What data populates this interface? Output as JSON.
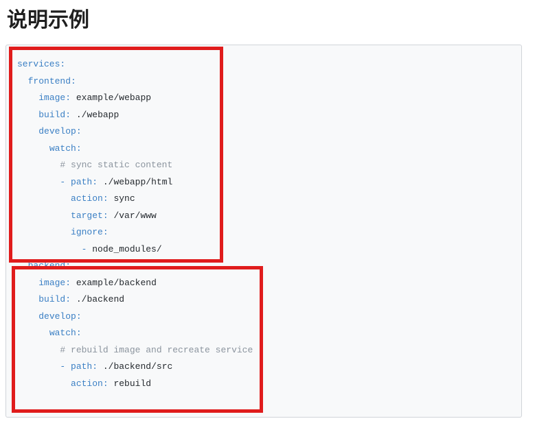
{
  "page": {
    "heading": "说明示例"
  },
  "code": {
    "language": "yaml",
    "lines": [
      {
        "indent": 0,
        "key": "services"
      },
      {
        "indent": 1,
        "key": "frontend"
      },
      {
        "indent": 2,
        "key": "image",
        "value": "example/webapp"
      },
      {
        "indent": 2,
        "key": "build",
        "value": "./webapp"
      },
      {
        "indent": 2,
        "key": "develop"
      },
      {
        "indent": 3,
        "key": "watch"
      },
      {
        "indent": 4,
        "comment": "# sync static content"
      },
      {
        "indent": 4,
        "dash": true,
        "key": "path",
        "value": "./webapp/html"
      },
      {
        "indent": 5,
        "key": "action",
        "value": "sync"
      },
      {
        "indent": 5,
        "key": "target",
        "value": "/var/www"
      },
      {
        "indent": 5,
        "key": "ignore"
      },
      {
        "indent": 6,
        "dash": true,
        "value": "node_modules/"
      },
      {
        "indent": 1,
        "key": "backend"
      },
      {
        "indent": 2,
        "key": "image",
        "value": "example/backend"
      },
      {
        "indent": 2,
        "key": "build",
        "value": "./backend"
      },
      {
        "indent": 2,
        "key": "develop"
      },
      {
        "indent": 3,
        "key": "watch"
      },
      {
        "indent": 4,
        "comment": "# rebuild image and recreate service"
      },
      {
        "indent": 4,
        "dash": true,
        "key": "path",
        "value": "./backend/src"
      },
      {
        "indent": 5,
        "key": "action",
        "value": "rebuild"
      }
    ]
  },
  "highlights": [
    {
      "label": "frontend",
      "color": "#e01c1c"
    },
    {
      "label": "backend",
      "color": "#e01c1c"
    }
  ],
  "colors": {
    "key": "#3a7fc4",
    "value": "#24292e",
    "comment": "#8b949e",
    "background": "#f8f9fa",
    "highlight_border": "#e01c1c"
  }
}
